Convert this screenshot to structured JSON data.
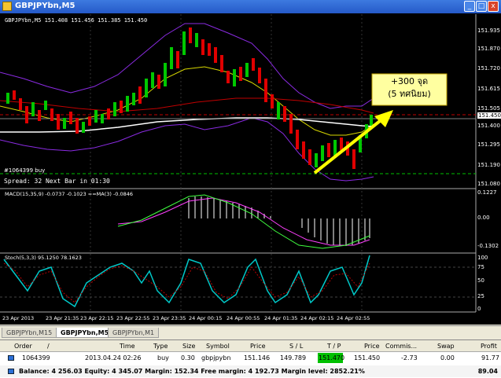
{
  "window": {
    "title": "GBPJPYbn,M5",
    "minimize": "_",
    "maximize": "□",
    "close": "x"
  },
  "chart_info": "GBPJPYbn,M5  151.408 151.456 151.385 151.450",
  "order_label": "#1064399 buy",
  "spread_label": "Spread: 32  Next Bar in 01:30",
  "annotation": {
    "line1": "+300 จุด",
    "line2": "(5 ทศนิยม)"
  },
  "price_axis": [
    "151.935",
    "151.870",
    "151.720",
    "151.615",
    "151.505",
    "151.450",
    "151.400",
    "151.295",
    "151.190",
    "151.080"
  ],
  "macd": {
    "label": "MACD(15,35,9) -0.0737 -0.1023  ==MA(3) -0.0846",
    "axis": [
      "0.1227",
      "0.00",
      "-0.1302"
    ]
  },
  "stoch": {
    "label": "Stoch(5,3,3) 95.1250 78.1623",
    "axis": [
      "100",
      "75",
      "50",
      "25",
      "0"
    ]
  },
  "time_axis": [
    "23 Apr 2013",
    "23 Apr 21:35",
    "23 Apr 22:15",
    "23 Apr 22:55",
    "23 Apr 23:35",
    "24 Apr 00:15",
    "24 Apr 00:55",
    "24 Apr 01:35",
    "24 Apr 02:15",
    "24 Apr 02:55"
  ],
  "tabs": [
    "GBPJPYbn,M15",
    "GBPJPYbn,M5",
    "GBPJPYbn,M1"
  ],
  "table": {
    "headers": [
      "Order",
      "/",
      "Time",
      "Type",
      "Size",
      "Symbol",
      "Price",
      "S / L",
      "T / P",
      "Price",
      "Commis...",
      "Swap",
      "Profit"
    ],
    "row": [
      "1064399",
      "2013.04.24 02:26",
      "buy",
      "0.30",
      "gbpjpybn",
      "151.146",
      "149.789",
      "151.470",
      "151.450",
      "-2.73",
      "0.00",
      "91.77"
    ]
  },
  "balance": {
    "text": "Balance: 4 256.03  Equity: 4 345.07  Margin: 152.34  Free margin: 4 192.73  Margin level: 2852.21%",
    "profit": "89.04"
  },
  "colors": {
    "bull": "#00c800",
    "bear": "#e00000",
    "bg": "#000000",
    "tp": "#00c000",
    "arrow": "#ffff00"
  }
}
